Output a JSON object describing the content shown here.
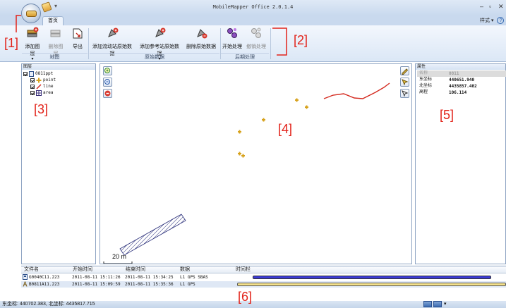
{
  "window": {
    "title": "MobileMapper Office 2.0.1.4",
    "minimize": "–",
    "maximize": "▫",
    "close": "✕"
  },
  "quick_access": {
    "arrow": "▾"
  },
  "tabs": [
    {
      "label": "首页"
    }
  ],
  "style_menu": {
    "label": "样式",
    "arrow": "▾",
    "help": "?"
  },
  "ribbon": {
    "groups": [
      {
        "label": "地图",
        "buttons": [
          {
            "label": "添加图层",
            "arrow": "▾",
            "enabled": true
          },
          {
            "label": "删除图层",
            "enabled": false
          },
          {
            "label": "导出",
            "enabled": true
          }
        ]
      },
      {
        "label": "原始数据",
        "buttons": [
          {
            "label": "添加流动站原始数据",
            "enabled": true
          },
          {
            "label": "添加参考站原始数据",
            "arrow": "▾",
            "enabled": true
          },
          {
            "label": "删除原始数据",
            "enabled": true
          }
        ]
      },
      {
        "label": "后期处理",
        "buttons": [
          {
            "label": "开始处理",
            "enabled": true
          },
          {
            "label": "撤销处理",
            "enabled": false
          }
        ]
      }
    ]
  },
  "layers_panel": {
    "title": "图层",
    "root": "0811ppt",
    "items": [
      {
        "label": "point",
        "icon": "point-icon"
      },
      {
        "label": "line",
        "icon": "line-icon"
      },
      {
        "label": "area",
        "icon": "area-icon"
      }
    ]
  },
  "map": {
    "scale_label": "20 m",
    "left_tools": [
      "zoom-in-icon",
      "zoom-out-icon",
      "stop-icon"
    ],
    "right_tools": [
      "pencil-icon",
      "select-icon",
      "edit-vertex-icon"
    ]
  },
  "properties_panel": {
    "title": "属性",
    "rows": [
      {
        "key": "名称",
        "value": "0811",
        "muted": true
      },
      {
        "key": "东坐标",
        "value": "440651.940"
      },
      {
        "key": "北坐标",
        "value": "4435857.402"
      },
      {
        "key": "高程",
        "value": "106.114"
      }
    ]
  },
  "raw_data_table": {
    "columns": [
      "文件名",
      "开始时间",
      "结束时间",
      "数据",
      "时间栏"
    ],
    "rows": [
      {
        "file": "G0040C11.223",
        "start": "2011-08-11 15:11:26",
        "end": "2011-08-11 15:34:25",
        "data": "L1 GPS SBAS",
        "icon": "receiver-icon"
      },
      {
        "file": "B0811A11.223",
        "start": "2011-08-11 15:09:59",
        "end": "2011-08-11 15:35:36",
        "data": "L1 GPS",
        "icon": "antenna-icon",
        "selected": true
      }
    ]
  },
  "status_bar": {
    "coords": "东坐标: 440702.383, 北坐标: 4435817.715",
    "arrow": "▾"
  },
  "annotations": [
    "[1]",
    "[2]",
    "[3]",
    "[4]",
    "[5]",
    "[6]"
  ],
  "colors": {
    "annotation": "#e2231a",
    "ribbon_top": "#f3f7fd",
    "timebar_rover": "#3b3bd6",
    "timebar_base": "#f3e08a"
  }
}
